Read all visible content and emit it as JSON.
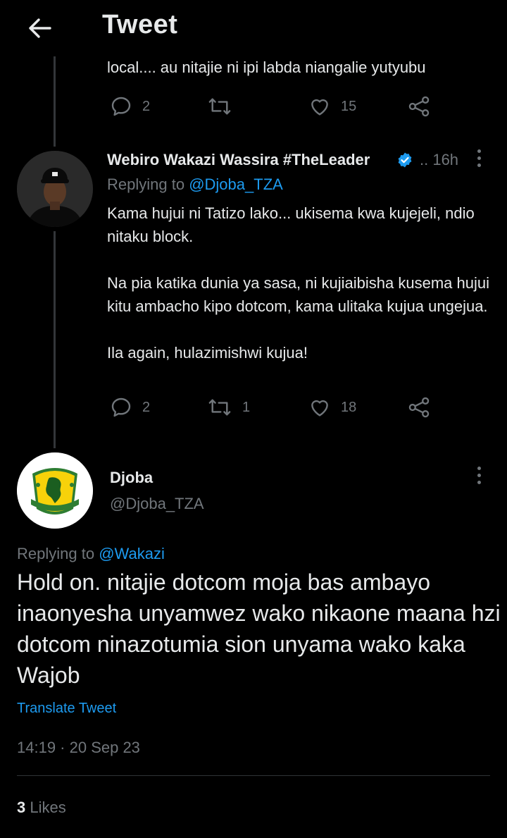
{
  "header": {
    "title": "Tweet",
    "back_icon": "arrow-left-icon"
  },
  "previous_tweet": {
    "cut_text": "local.... au nitajie ni ipi labda niangalie yutyubu",
    "reply_count": "2",
    "retweet_count": "",
    "like_count": "15"
  },
  "tweet1": {
    "author_name": "Webiro Wakazi Wassira #TheLeader",
    "time": ".. 16h",
    "replying_prefix": "Replying to",
    "replying_to": "@Djoba_TZA",
    "paragraphs": [
      "Kama hujui ni Tatizo lako...  ukisema kwa kujejeli, ndio nitaku block.",
      "Na pia katika dunia ya sasa, ni kujiaibisha kusema hujui kitu ambacho kipo dotcom, kama ulitaka kujua ungejua.",
      "Ila again, hulazimishwi kujua!"
    ],
    "reply_count": "2",
    "retweet_count": "1",
    "like_count": "18"
  },
  "main_tweet": {
    "author_name": "Djoba",
    "handle": "@Djoba_TZA",
    "replying_prefix": "Replying to",
    "replying_to": "@Wakazi",
    "text": "Hold on. nitajie dotcom moja bas ambayo inaonyesha unyamwez wako nikaone maana hzi dotcom ninazotumia sion unyama wako kaka Wajob",
    "translate_label": "Translate Tweet",
    "timestamp": "14:19 · 20 Sep 23",
    "likes_count": "3",
    "likes_label": "Likes"
  },
  "colors": {
    "background": "#000000",
    "text_primary": "#e7e9ea",
    "text_secondary": "#71767b",
    "accent": "#1d9bf0"
  }
}
